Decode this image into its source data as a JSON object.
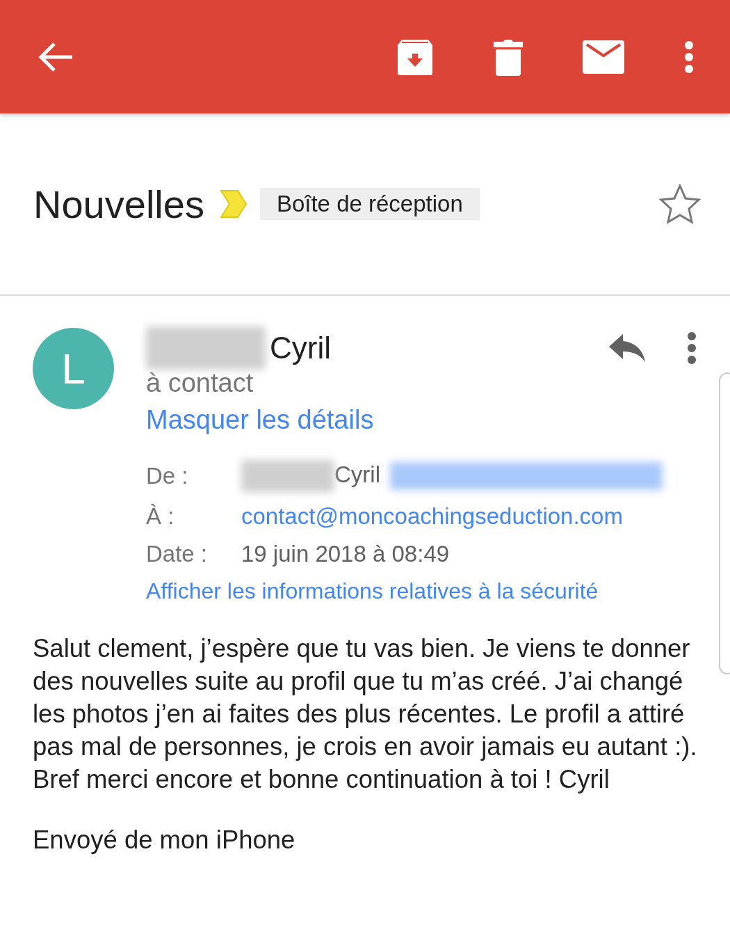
{
  "subject": {
    "title": "Nouvelles",
    "important": true,
    "label": "Boîte de réception",
    "starred": false
  },
  "message": {
    "avatar": {
      "letter": "L",
      "color": "#4db6ac"
    },
    "sender": "Cyril",
    "recipient_line": "à contact",
    "details_link": "Masquer les détails",
    "details": [
      {
        "kind": "sender",
        "label": "De :",
        "value": "Cyril"
      },
      {
        "kind": "link",
        "label": "À :",
        "value": "contact@moncoachingseduction.com"
      },
      {
        "kind": "text",
        "label": "Date :",
        "value": "19 juin 2018 à 08:49"
      }
    ],
    "security_link": "Afficher les informations relatives à la sécurité",
    "body": [
      "Salut clement, j’espère que tu vas bien. Je viens te donner des nouvelles suite au profil que tu m’as créé. J’ai changé les photos j’en ai faites des plus récentes. Le profil a attiré pas mal de personnes, je crois en avoir jamais eu autant :). Bref merci encore et bonne continuation à toi ! Cyril",
      "Envoyé de mon iPhone"
    ]
  }
}
